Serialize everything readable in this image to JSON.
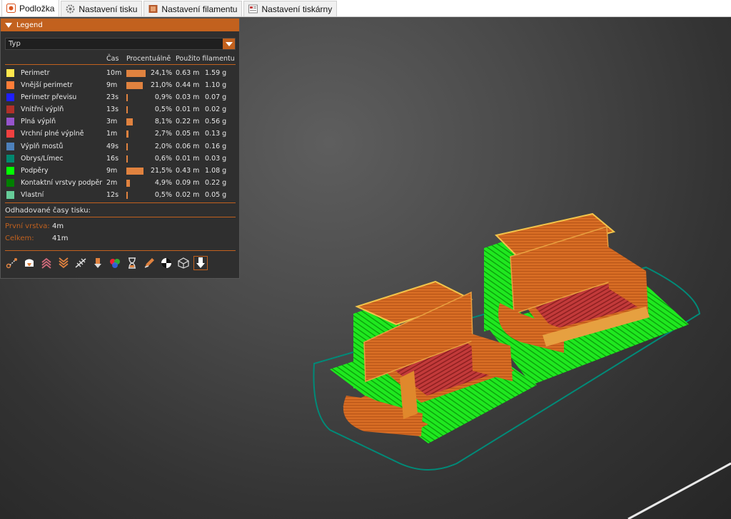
{
  "tabs": [
    {
      "label": "Podložka",
      "icon": "plater-icon",
      "color": "#d9541e",
      "active": true
    },
    {
      "label": "Nastavení tisku",
      "icon": "gear-icon",
      "color": "#888888",
      "active": false
    },
    {
      "label": "Nastavení filamentu",
      "icon": "spool-icon",
      "color": "#b4582a",
      "active": false
    },
    {
      "label": "Nastavení tiskárny",
      "icon": "printer-icon",
      "color": "#b06060",
      "active": false
    }
  ],
  "legend": {
    "title": "Legend",
    "view_type": "Typ",
    "columns": {
      "time": "Čas",
      "percent": "Procentuálně",
      "filament": "Použito filamentu"
    },
    "rows": [
      {
        "color": "#ffe64d",
        "label": "Perimetr",
        "time": "10m",
        "share": 24.1,
        "percent": "24,1%",
        "length": "0.63 m",
        "weight": "1.59 g"
      },
      {
        "color": "#ff7d38",
        "label": "Vnější perimetr",
        "time": "9m",
        "share": 21.0,
        "percent": "21,0%",
        "length": "0.44 m",
        "weight": "1.10 g"
      },
      {
        "color": "#1f1fff",
        "label": "Perimetr převisu",
        "time": "23s",
        "share": 0.9,
        "percent": "0,9%",
        "length": "0.03 m",
        "weight": "0.07 g"
      },
      {
        "color": "#b03029",
        "label": "Vnitřní výplň",
        "time": "13s",
        "share": 0.5,
        "percent": "0,5%",
        "length": "0.01 m",
        "weight": "0.02 g"
      },
      {
        "color": "#9654cc",
        "label": "Plná výplň",
        "time": "3m",
        "share": 8.1,
        "percent": "8,1%",
        "length": "0.22 m",
        "weight": "0.56 g"
      },
      {
        "color": "#f04040",
        "label": "Vrchní plné výplně",
        "time": "1m",
        "share": 2.7,
        "percent": "2,7%",
        "length": "0.05 m",
        "weight": "0.13 g"
      },
      {
        "color": "#4d80ba",
        "label": "Výplň mostů",
        "time": "49s",
        "share": 2.0,
        "percent": "2,0%",
        "length": "0.06 m",
        "weight": "0.16 g"
      },
      {
        "color": "#00876e",
        "label": "Obrys/Límec",
        "time": "16s",
        "share": 0.6,
        "percent": "0,6%",
        "length": "0.01 m",
        "weight": "0.03 g"
      },
      {
        "color": "#00ff00",
        "label": "Podpěry",
        "time": "9m",
        "share": 21.5,
        "percent": "21,5%",
        "length": "0.43 m",
        "weight": "1.08 g"
      },
      {
        "color": "#008000",
        "label": "Kontaktní vrstvy podpěr",
        "time": "2m",
        "share": 4.9,
        "percent": "4,9%",
        "length": "0.09 m",
        "weight": "0.22 g"
      },
      {
        "color": "#66cc99",
        "label": "Vlastní",
        "time": "12s",
        "share": 0.5,
        "percent": "0,5%",
        "length": "0.02 m",
        "weight": "0.05 g"
      }
    ],
    "estimated_label": "Odhadované časy tisku:",
    "first_layer_label": "První vrstva:",
    "first_layer_value": "4m",
    "total_label": "Celkem:",
    "total_value": "41m"
  },
  "toolbar_icons": [
    "travel-icon",
    "wipe-icon",
    "retractions-icon",
    "deretractions-icon",
    "seams-icon",
    "tool-changes-icon",
    "color-changes-icon",
    "pause-prints-icon",
    "custom-gcode-icon",
    "center-of-gravity-icon",
    "shells-icon",
    "tool-marker-icon"
  ],
  "scene": {
    "accent": "#d9772e",
    "support_color": "#00ff00",
    "skirt_color": "#008a78"
  }
}
